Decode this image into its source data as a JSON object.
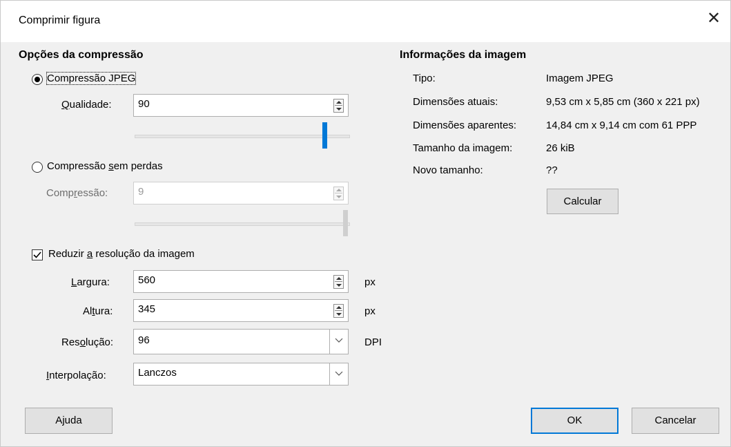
{
  "window": {
    "title": "Comprimir figura"
  },
  "compression": {
    "heading": "Opções da compressão",
    "jpeg": {
      "label": "Compressão JPEG",
      "selected": true
    },
    "quality": {
      "label": "Qualidade:",
      "value": "90",
      "slider_fraction": 0.9
    },
    "lossless": {
      "label": "Compressão sem perdas",
      "selected": false
    },
    "level": {
      "label": "Compressão:",
      "value": "9",
      "slider_fraction": 1.0
    },
    "reduce": {
      "label": "Reduzir a resolução da imagem",
      "checked": true
    },
    "width": {
      "label": "Largura:",
      "value": "560",
      "unit": "px"
    },
    "height": {
      "label": "Altura:",
      "value": "345",
      "unit": "px"
    },
    "resolution": {
      "label": "Resolução:",
      "value": "96",
      "unit": "DPI"
    },
    "interpolation": {
      "label": "Interpolação:",
      "value": "Lanczos"
    }
  },
  "info": {
    "heading": "Informações da imagem",
    "rows": [
      {
        "label": "Tipo:",
        "value": "Imagem JPEG"
      },
      {
        "label": "Dimensões atuais:",
        "value": "9,53 cm x 5,85 cm (360 x 221 px)"
      },
      {
        "label": "Dimensões aparentes:",
        "value": "14,84 cm x 9,14 cm com 61 PPP"
      },
      {
        "label": "Tamanho da imagem:",
        "value": "26 kiB"
      },
      {
        "label": "Novo tamanho:",
        "value": "??"
      }
    ],
    "calculate_label": "Calcular"
  },
  "buttons": {
    "help": "Ajuda",
    "ok": "OK",
    "cancel": "Cancelar"
  },
  "colors": {
    "accent": "#0078d7",
    "dialog_bg": "#f0f0f0"
  }
}
